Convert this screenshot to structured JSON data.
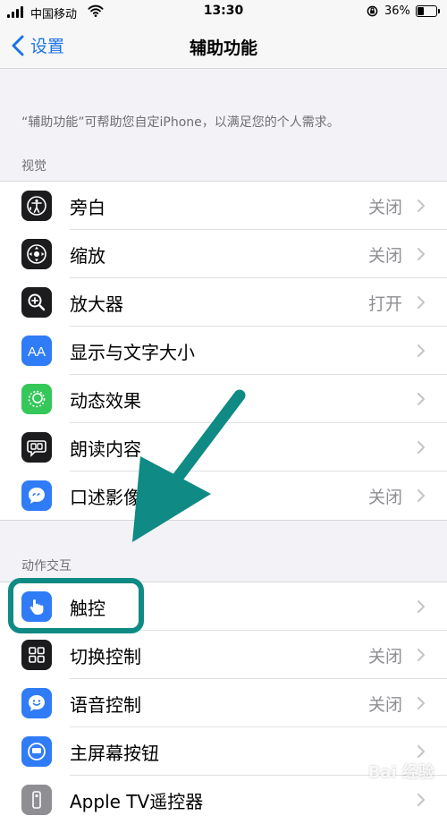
{
  "status_bar": {
    "carrier": "中国移动",
    "time": "13:30",
    "battery_pct": "36%"
  },
  "nav": {
    "back_label": "设置",
    "title": "辅助功能"
  },
  "description": "“辅助功能”可帮助您自定iPhone，以满足您的个人需求。",
  "sections": [
    {
      "header": "视觉",
      "items": [
        {
          "label": "旁白",
          "value": "关闭",
          "icon": "voiceover-icon",
          "color": "#1c1c1e"
        },
        {
          "label": "缩放",
          "value": "关闭",
          "icon": "zoom-icon",
          "color": "#1c1c1e"
        },
        {
          "label": "放大器",
          "value": "打开",
          "icon": "magnifier-icon",
          "color": "#1c1c1e"
        },
        {
          "label": "显示与文字大小",
          "value": "",
          "icon": "text-size-icon",
          "color": "#2f7cf6"
        },
        {
          "label": "动态效果",
          "value": "",
          "icon": "motion-icon",
          "color": "#34c759"
        },
        {
          "label": "朗读内容",
          "value": "",
          "icon": "spoken-content-icon",
          "color": "#1c1c1e"
        },
        {
          "label": "口述影像",
          "value": "关闭",
          "icon": "audio-description-icon",
          "color": "#2f7cf6"
        }
      ]
    },
    {
      "header": "动作交互",
      "items": [
        {
          "label": "触控",
          "value": "",
          "icon": "touch-icon",
          "color": "#2f7cf6"
        },
        {
          "label": "切换控制",
          "value": "关闭",
          "icon": "switch-control-icon",
          "color": "#1c1c1e"
        },
        {
          "label": "语音控制",
          "value": "关闭",
          "icon": "voice-control-icon",
          "color": "#2f7cf6"
        },
        {
          "label": "主屏幕按钮",
          "value": "",
          "icon": "home-button-icon",
          "color": "#2f7cf6"
        },
        {
          "label": "Apple TV遥控器",
          "value": "",
          "icon": "remote-icon",
          "color": "#8e8e93"
        }
      ]
    }
  ],
  "watermark": "Bai 经验",
  "colors": {
    "accent": "#1a73e8",
    "annotation": "#0f8a84"
  }
}
